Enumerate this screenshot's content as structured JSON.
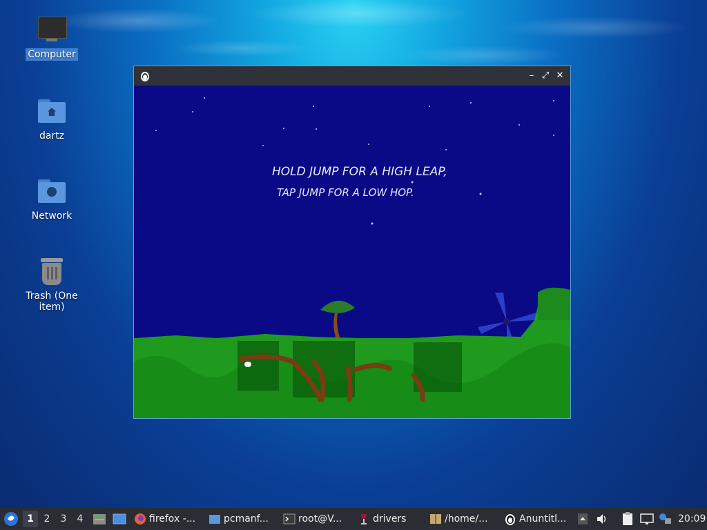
{
  "desktop": {
    "icons": [
      {
        "label": "Computer"
      },
      {
        "label": "dartz"
      },
      {
        "label": "Network"
      },
      {
        "label": "Trash (One item)"
      }
    ]
  },
  "window": {
    "controls": {
      "minimize": "–",
      "maximize": "⤢",
      "close": "✕"
    }
  },
  "game": {
    "hint_line1": "HOLD JUMP FOR A HIGH LEAP,",
    "hint_line2": "TAP JUMP FOR A LOW HOP."
  },
  "taskbar": {
    "workspaces": [
      "1",
      "2",
      "3",
      "4"
    ],
    "tasks": [
      {
        "label": "firefox -..."
      },
      {
        "label": "pcmanf..."
      },
      {
        "label": "root@V..."
      },
      {
        "label": "drivers"
      },
      {
        "label": "/home/..."
      },
      {
        "label": "Anuntitl..."
      }
    ],
    "clock": "20:09"
  }
}
